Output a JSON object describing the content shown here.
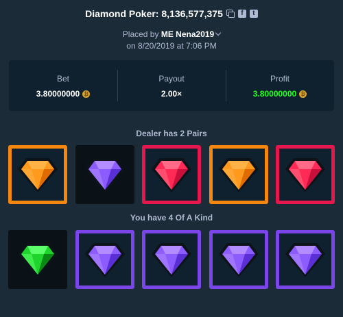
{
  "header": {
    "title": "Diamond Poker: 8,136,577,375",
    "placed_prefix": "Placed by",
    "user_badge": "ME",
    "username": "Nena2019",
    "date_line": "on 8/20/2019 at 7:06 PM"
  },
  "stats": {
    "bet_label": "Bet",
    "bet_value": "3.80000000",
    "payout_label": "Payout",
    "payout_value": "2.00×",
    "profit_label": "Profit",
    "profit_value": "3.80000000",
    "coin_glyph": "₿"
  },
  "icons": {
    "facebook": "f",
    "twitter": "t"
  },
  "dealer": {
    "label": "Dealer has 2 Pairs",
    "cards": [
      {
        "gem": "orange",
        "frame": "#f5870f",
        "highlighted": true
      },
      {
        "gem": "purple",
        "frame": null,
        "highlighted": false
      },
      {
        "gem": "red",
        "frame": "#e6174c",
        "highlighted": true
      },
      {
        "gem": "orange",
        "frame": "#f5870f",
        "highlighted": true
      },
      {
        "gem": "red",
        "frame": "#e6174c",
        "highlighted": true
      }
    ]
  },
  "player": {
    "label": "You have 4 Of A Kind",
    "cards": [
      {
        "gem": "green",
        "frame": null,
        "highlighted": false
      },
      {
        "gem": "purple",
        "frame": "#7b46e9",
        "highlighted": true
      },
      {
        "gem": "purple",
        "frame": "#7b46e9",
        "highlighted": true
      },
      {
        "gem": "purple",
        "frame": "#7b46e9",
        "highlighted": true
      },
      {
        "gem": "purple",
        "frame": "#7b46e9",
        "highlighted": true
      }
    ]
  },
  "colors": {
    "background": "#1b2c38",
    "panel": "#0f212e",
    "profit": "#1fff20",
    "muted_text": "#b1bad3"
  }
}
